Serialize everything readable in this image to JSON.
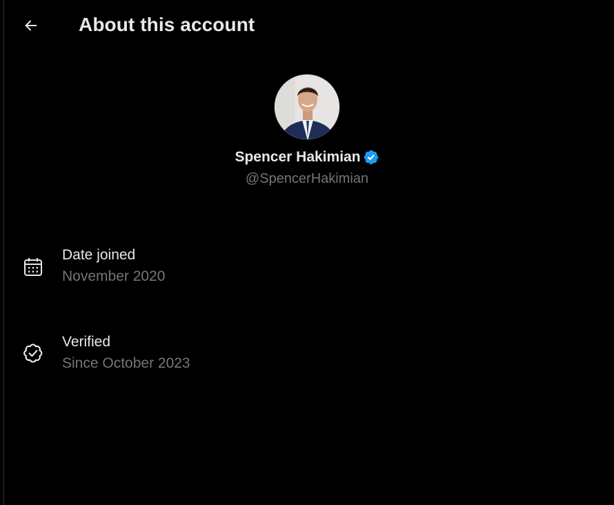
{
  "header": {
    "back_icon": "arrow-left-icon",
    "title": "About this account"
  },
  "profile": {
    "display_name": "Spencer Hakimian",
    "handle": "@SpencerHakimian",
    "verified_badge_icon": "verified-badge-icon",
    "badge_color": "#1d9bf0"
  },
  "details": [
    {
      "icon": "calendar-icon",
      "label": "Date joined",
      "value": "November 2020"
    },
    {
      "icon": "verified-check-icon",
      "label": "Verified",
      "value": "Since October 2023"
    }
  ],
  "colors": {
    "background": "#000000",
    "primary_text": "#e7e9ea",
    "secondary_text": "#71767b",
    "accent": "#1d9bf0"
  }
}
